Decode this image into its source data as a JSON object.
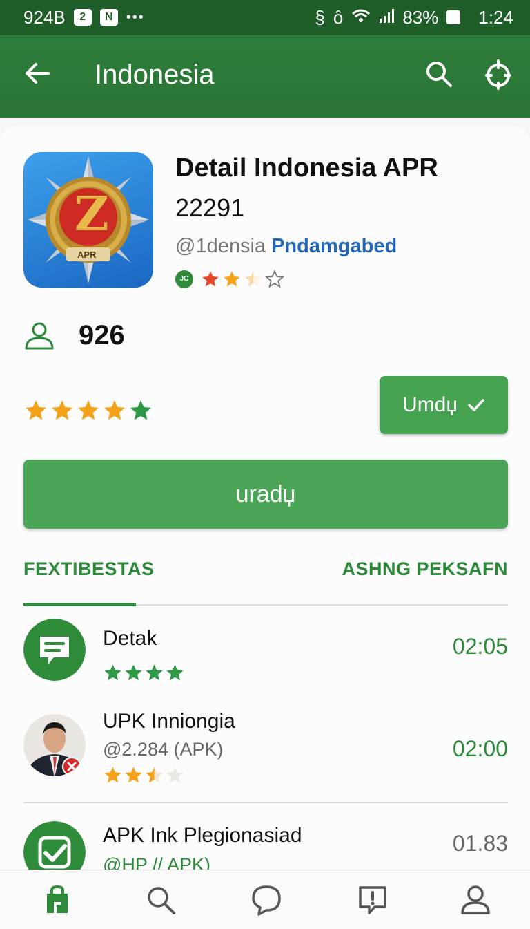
{
  "status_bar": {
    "left_text": "924B",
    "box_a": "2",
    "box_b": "N",
    "dots": "•••",
    "battery": "83%",
    "time": "1:24"
  },
  "app_bar": {
    "title": "Indonesia",
    "icons": [
      "arrow-back-icon",
      "search-icon",
      "compass-icon"
    ]
  },
  "app": {
    "title": "Detail Indonesia APR",
    "code": "22291",
    "developer_handle": "@1densia",
    "developer_name": "Pndamgabed",
    "badge": "JC",
    "rating_stars": 2.5,
    "icon_emblem_text": "APR",
    "icon_emblem_symbol": "Z",
    "users_count": "926",
    "overall_stars": 5,
    "small_button_label": "Umdџ",
    "primary_button_label": "uradџ"
  },
  "tabs": [
    {
      "label": "FEXTIBESTAS",
      "active": true
    },
    {
      "label": "ASHNG PEKSAFN",
      "active": false
    }
  ],
  "list": [
    {
      "name": "Detak",
      "sub": "",
      "stars": 4,
      "time": "02:05",
      "avatar": "chat-bubble-icon"
    },
    {
      "name": "UPK Inniongia",
      "sub": "@2.284 (APK)",
      "stars": 2.5,
      "time": "02:00",
      "avatar": "person-photo"
    },
    {
      "name": "APK Ink Plegionasiad",
      "sub": "@HP // APK)",
      "stars": 0,
      "time": "01.83",
      "avatar": "check-icon"
    }
  ],
  "colors": {
    "primary": "#2e7d3a",
    "button": "#4aa557",
    "accent_text": "#2d8a3b",
    "star_orange": "#f4a21a",
    "star_red": "#e8472c",
    "link_blue": "#2466b8"
  },
  "bottom_nav": [
    "home-icon",
    "search-icon",
    "chat-icon",
    "feedback-icon",
    "profile-icon"
  ]
}
